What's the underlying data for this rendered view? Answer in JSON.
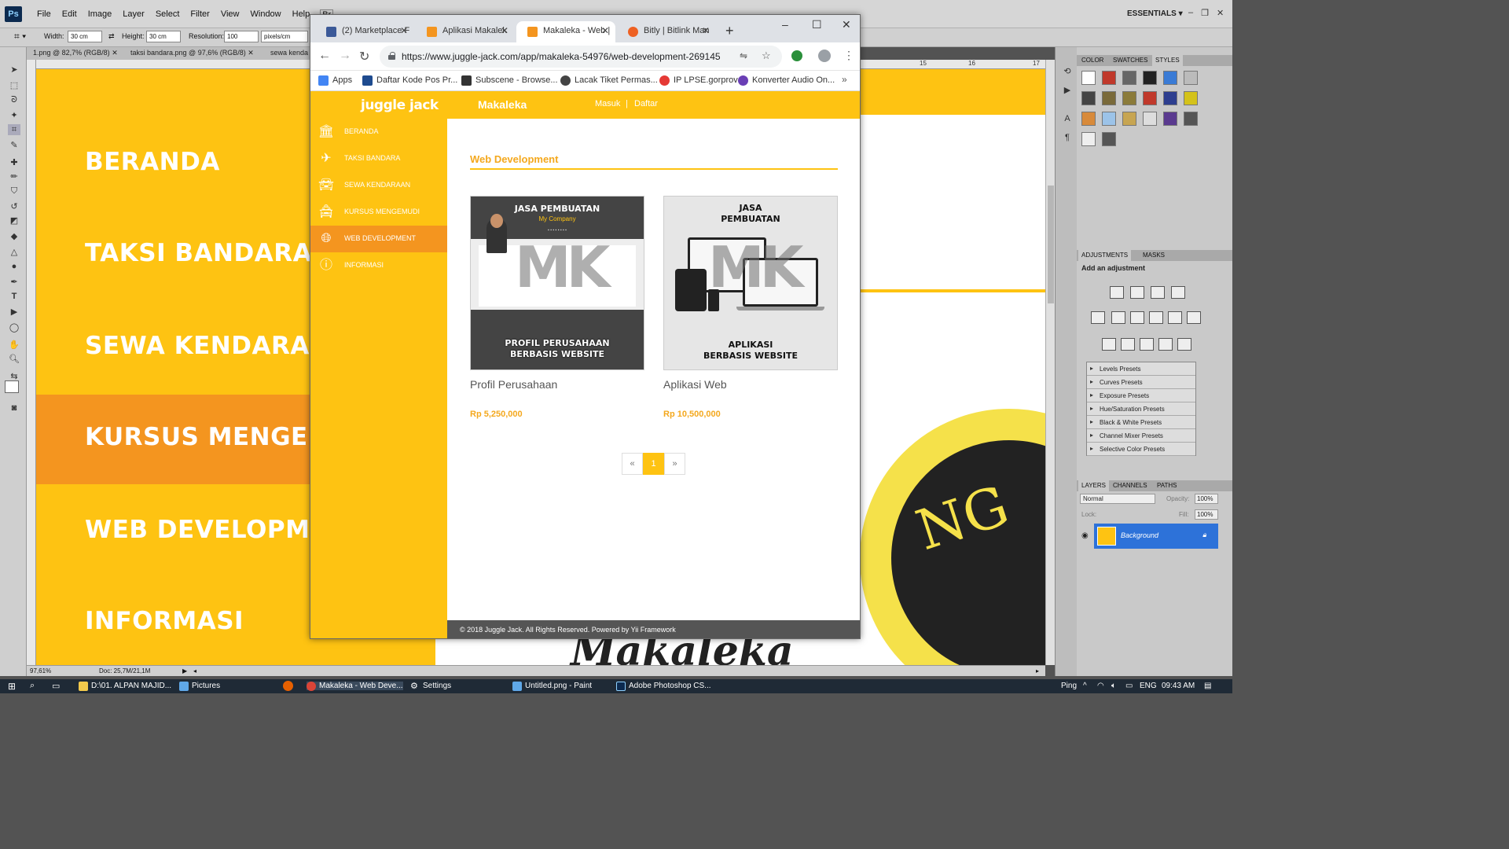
{
  "photoshop": {
    "logo": "Ps",
    "menu": [
      "File",
      "Edit",
      "Image",
      "Layer",
      "Select",
      "Filter",
      "View",
      "Window",
      "Help",
      "Br"
    ],
    "workspace": "ESSENTIALS",
    "options": {
      "width_label": "Width:",
      "width_value": "30 cm",
      "height_label": "Height:",
      "height_value": "30 cm",
      "resolution_label": "Resolution:",
      "resolution_value": "100",
      "resolution_unit": "pixels/cm"
    },
    "doc_tabs": [
      "1.png @ 82,7% (RGB/8)",
      "taksi bandara.png @ 97,6% (RGB/8)",
      "sewa kenda"
    ],
    "ruler_numbers": [
      "15",
      "16",
      "17"
    ],
    "canvas": {
      "items": [
        "BERANDA",
        "TAKSI BANDARA",
        "SEWA KENDARAAN",
        "KURSUS MENGEMUI",
        "WEB DEVELOPMENT",
        "INFORMASI"
      ],
      "logo_text": "NG",
      "logo_bottom": "Makaleka"
    },
    "status": {
      "zoom": "97,61%",
      "doc": "Doc: 25,7M/21,1M"
    },
    "panels": {
      "top_tabs": [
        "COLOR",
        "SWATCHES",
        "STYLES"
      ],
      "adj_tabs": [
        "ADJUSTMENTS",
        "MASKS"
      ],
      "adj_title": "Add an adjustment",
      "presets": [
        "Levels Presets",
        "Curves Presets",
        "Exposure Presets",
        "Hue/Saturation Presets",
        "Black & White Presets",
        "Channel Mixer Presets",
        "Selective Color Presets"
      ],
      "layer_tabs": [
        "LAYERS",
        "CHANNELS",
        "PATHS"
      ],
      "blend_mode": "Normal",
      "opacity_label": "Opacity:",
      "opacity_value": "100%",
      "lock_label": "Lock:",
      "fill_label": "Fill:",
      "fill_value": "100%",
      "layer_name": "Background"
    }
  },
  "browser": {
    "tabs": [
      {
        "title": "(2) Marketplace F",
        "color": "#3b5998"
      },
      {
        "title": "Aplikasi Makalek",
        "color": "#f4951f"
      },
      {
        "title": "Makaleka - Web |",
        "color": "#f4951f",
        "active": true
      },
      {
        "title": "Bitly | Bitlink Man",
        "color": "#ee6123"
      }
    ],
    "url": "https://www.juggle-jack.com/app/makaleka-54976/web-development-269145",
    "bookmarks": [
      {
        "label": "Apps",
        "color": "#4285f4"
      },
      {
        "label": "Daftar Kode Pos Pr...",
        "color": "#1e4b8f"
      },
      {
        "label": "Subscene - Browse...",
        "color": "#333333"
      },
      {
        "label": "Lacak Tiket Permas...",
        "color": "#444444"
      },
      {
        "label": "IP LPSE.gorprov",
        "color": "#e53935"
      },
      {
        "label": "Konverter Audio On...",
        "color": "#6a3fb5"
      }
    ]
  },
  "site": {
    "logo": "juggle jack",
    "brand": "Makaleka",
    "login": "Masuk",
    "separator": "|",
    "register": "Daftar",
    "nav": [
      {
        "label": "BERANDA",
        "icon": "bank-icon"
      },
      {
        "label": "TAKSI BANDARA",
        "icon": "plane-icon"
      },
      {
        "label": "SEWA KENDARAAN",
        "icon": "car-icon"
      },
      {
        "label": "KURSUS MENGEMUDI",
        "icon": "taxi-icon"
      },
      {
        "label": "WEB DEVELOPMENT",
        "icon": "globe-icon",
        "active": true
      },
      {
        "label": "INFORMASI",
        "icon": "info-icon"
      }
    ],
    "section_title": "Web Development",
    "products": [
      {
        "name": "Profil Perusahaan",
        "price": "Rp 5,250,000",
        "img_title": "JASA PEMBUATAN",
        "img_sub": "My Company",
        "img_caption_1": "PROFIL PERUSAHAAN",
        "img_caption_2": "BERBASIS WEBSITE",
        "watermark": "MK"
      },
      {
        "name": "Aplikasi Web",
        "price": "Rp 10,500,000",
        "img_title_1": "JASA",
        "img_title_2": "PEMBUATAN",
        "img_caption_1": "APLIKASI",
        "img_caption_2": "BERBASIS WEBSITE",
        "watermark": "MK"
      }
    ],
    "pager": {
      "prev": "«",
      "current": "1",
      "next": "»"
    },
    "footer": "© 2018 Juggle Jack. All Rights Reserved. Powered by Yii Framework"
  },
  "taskbar": {
    "items": [
      {
        "label": "D:\\01. ALPAN MAJID...",
        "color": "#f2c94c"
      },
      {
        "label": "Pictures",
        "color": "#5fa8e8"
      },
      {
        "label": "Makaleka - Web Deve...",
        "color": "#db4437",
        "active": true
      },
      {
        "label": "Settings",
        "color": "#ffffff"
      },
      {
        "label": "Untitled.png - Paint",
        "color": "#5fa8e8"
      },
      {
        "label": "Adobe Photoshop CS...",
        "color": "#0c2a4f"
      }
    ],
    "ping": "Ping",
    "lang": "ENG",
    "time": "09:43 AM"
  }
}
